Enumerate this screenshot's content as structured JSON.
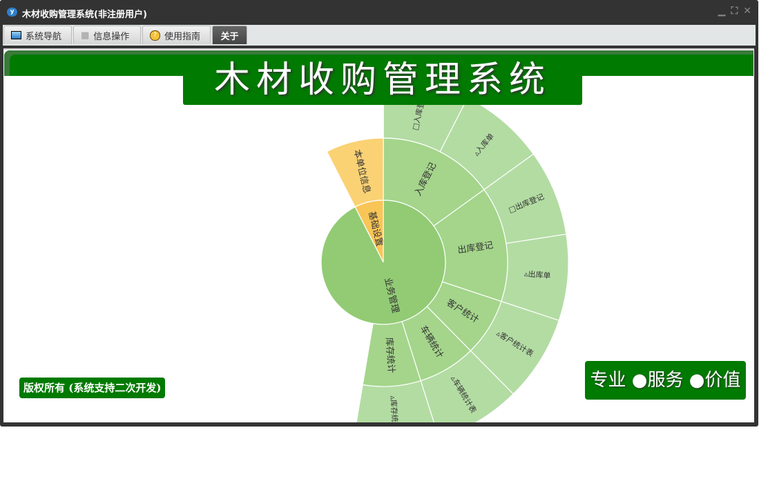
{
  "window": {
    "title": "木材收购管理系统(非注册用户)",
    "controls": [
      "minimize",
      "restore",
      "close"
    ]
  },
  "tabs": [
    {
      "label": "系统导航",
      "icon": "monitor-icon"
    },
    {
      "label": "信息操作",
      "icon": "grid-icon"
    },
    {
      "label": "使用指南",
      "icon": "help-icon"
    },
    {
      "label": "关于",
      "active": true
    }
  ],
  "main_title": "木材收购管理系统",
  "copyright": "版权所有 (系统支持二次开发)",
  "slogan": "专业 ●服务 ●价值",
  "chart_data": {
    "type": "sunburst",
    "start_angle_deg": -27,
    "children": [
      {
        "name": "基础设置",
        "value": 1,
        "color": "#f8c557",
        "children": [
          {
            "name": "本单位信息",
            "value": 1,
            "color": "#fad274"
          }
        ]
      },
      {
        "name": "业务管理",
        "value": 12.3,
        "color": "#92cb74",
        "children": [
          {
            "name": "入库登记",
            "value": 2,
            "children": [
              {
                "name": "□入库登记",
                "value": 1
              },
              {
                "name": "▵入库单",
                "value": 1
              }
            ]
          },
          {
            "name": "出库登记",
            "value": 2,
            "children": [
              {
                "name": "□出库登记",
                "value": 1
              },
              {
                "name": "▵出库单",
                "value": 1
              }
            ]
          },
          {
            "name": "客户统计",
            "value": 1,
            "children": [
              {
                "name": "▵客户统计表",
                "value": 1
              }
            ]
          },
          {
            "name": "车辆统计",
            "value": 1,
            "children": [
              {
                "name": "▵车辆统计表",
                "value": 1
              }
            ]
          },
          {
            "name": "库存统计",
            "value": 1,
            "children": [
              {
                "name": "▵库存统计表",
                "value": 1
              }
            ]
          }
        ]
      }
    ],
    "level_colors": [
      "#92cb74",
      "#a4d58b",
      "#b3dca3"
    ]
  }
}
